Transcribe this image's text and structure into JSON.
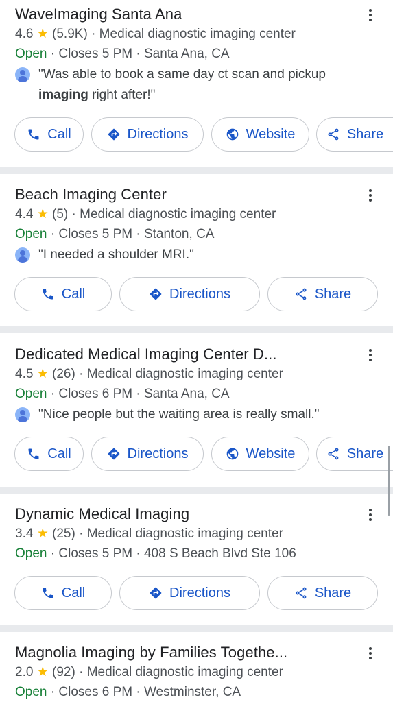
{
  "colors": {
    "accent": "#1a56c8",
    "open": "#188038",
    "star": "#fbbc04",
    "divider": "#e8eaed"
  },
  "listings": [
    {
      "name": "WaveImaging Santa Ana",
      "rating": "4.6",
      "reviews": "(5.9K)",
      "category": "Medical diagnostic imaging center",
      "status": "Open",
      "closes": "Closes 5 PM",
      "location": "Santa Ana, CA",
      "review_line1": "\"Was able to book a same day ct scan and pickup",
      "review_bold": "imaging",
      "review_line2_rest": " right after!\"",
      "buttons": {
        "call": "Call",
        "directions": "Directions",
        "website": "Website",
        "share": "Share"
      }
    },
    {
      "name": "Beach Imaging Center",
      "rating": "4.4",
      "reviews": "(5)",
      "category": "Medical diagnostic imaging center",
      "status": "Open",
      "closes": "Closes 5 PM",
      "location": "Stanton, CA",
      "review_line1": "\"I needed a shoulder MRI.\"",
      "buttons": {
        "call": "Call",
        "directions": "Directions",
        "share": "Share"
      }
    },
    {
      "name": "Dedicated Medical Imaging Center D...",
      "rating": "4.5",
      "reviews": "(26)",
      "category": "Medical diagnostic imaging center",
      "status": "Open",
      "closes": "Closes 6 PM",
      "location": "Santa Ana, CA",
      "review_line1": "\"Nice people but the waiting area is really small.\"",
      "buttons": {
        "call": "Call",
        "directions": "Directions",
        "website": "Website",
        "share": "Share"
      }
    },
    {
      "name": "Dynamic Medical Imaging",
      "rating": "3.4",
      "reviews": "(25)",
      "category": "Medical diagnostic imaging center",
      "status": "Open",
      "closes": "Closes 5 PM",
      "location": "408 S Beach Blvd Ste 106",
      "buttons": {
        "call": "Call",
        "directions": "Directions",
        "share": "Share"
      }
    },
    {
      "name": "Magnolia Imaging by Families Togethe...",
      "rating": "2.0",
      "reviews": "(92)",
      "category": "Medical diagnostic imaging center",
      "status": "Open",
      "closes": "Closes 6 PM",
      "location": "Westminster, CA"
    }
  ],
  "separators": {
    "dot": "·",
    "star_glyph": "★"
  }
}
